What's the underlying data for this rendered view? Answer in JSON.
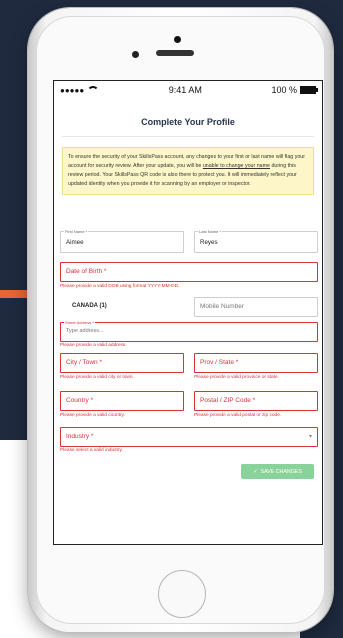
{
  "status": {
    "time": "9:41 AM",
    "battery": "100 %"
  },
  "page_title": "Complete Your Profile",
  "notice": {
    "part1": "To ensure the security of your SkillsPass account, any changes to your first or last name will flag your account for security review. After your update, you will be ",
    "underlined": "unable to change your name",
    "part2": " during this review period. Your SkillsPass QR code is also there to protect you. It will immediately reflect your updated identity when you provide it for scanning by an employer or inspector."
  },
  "first_name": {
    "label": "First Name *",
    "value": "Aimee"
  },
  "last_name": {
    "label": "Last Name *",
    "value": "Reyes"
  },
  "dob": {
    "placeholder": "Date of Birth *",
    "error": "Please provide a valid DOB using format YYYY-MM-DD."
  },
  "phone": {
    "country": "CANADA (1)",
    "placeholder": "Mobile Number"
  },
  "street": {
    "label": "Street Address *",
    "placeholder": "Type address...",
    "error": "Please provide a valid address."
  },
  "city": {
    "placeholder": "City / Town *",
    "error": "Please provide a valid city or town."
  },
  "prov": {
    "placeholder": "Prov / State *",
    "error": "Please provide a valid province or state."
  },
  "country": {
    "placeholder": "Country *",
    "error": "Please provide a valid country."
  },
  "postal": {
    "placeholder": "Postal / ZIP Code *",
    "error": "Please provide a valid postal or zip code."
  },
  "industry": {
    "placeholder": "Industry *",
    "error": "Please select a valid industry."
  },
  "save_label": "SAVE CHANGES",
  "colors": {
    "accent_red": "#d8323c",
    "save_green": "#89d39a",
    "navy_bg": "#1f2a3f",
    "orange": "#e4663a"
  }
}
